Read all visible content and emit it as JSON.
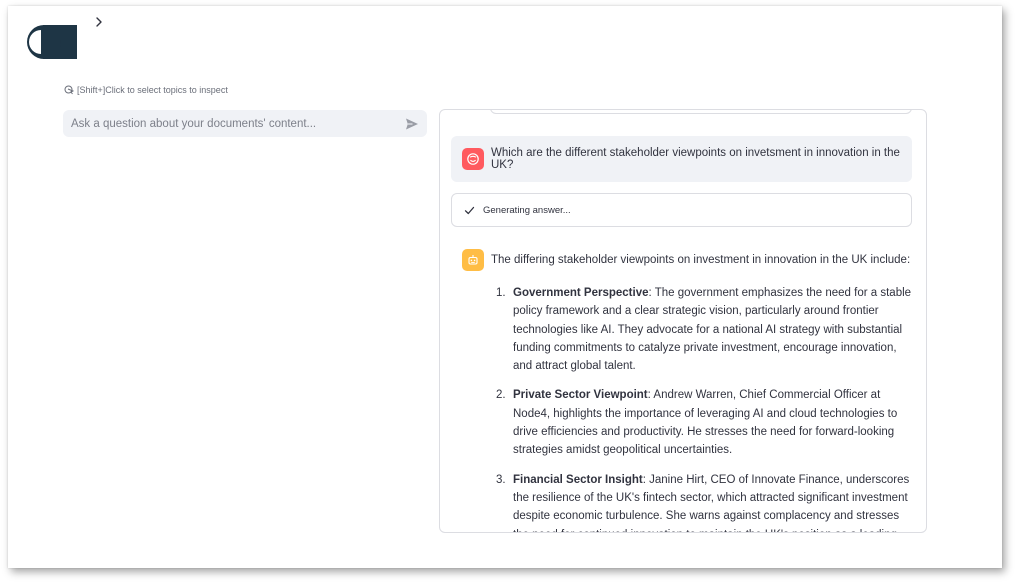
{
  "nav": {
    "logo_icon": "app-logo",
    "expand_icon": "chevron-right-icon"
  },
  "hint": {
    "icon": "inspect-cursor-icon",
    "text": "[Shift+]Click to select topics to inspect"
  },
  "query": {
    "placeholder": "Ask a question about your documents' content...",
    "value": "",
    "send_icon": "send-icon"
  },
  "chat": {
    "user_message": {
      "avatar_icon": "user-face-icon",
      "text": "Which are the different stakeholder viewpoints on invetsment in innovation in the UK?"
    },
    "status": {
      "icon": "check-icon",
      "text": "Generating answer..."
    },
    "assistant_message": {
      "avatar_icon": "robot-icon",
      "intro": "The differing stakeholder viewpoints on investment in innovation in the UK include:",
      "items": [
        {
          "number": "1.",
          "title": "Government Perspective",
          "body": ": The government emphasizes the need for a stable policy framework and a clear strategic vision, particularly around frontier technologies like AI. They advocate for a national AI strategy with substantial funding commitments to catalyze private investment, encourage innovation, and attract global talent."
        },
        {
          "number": "2.",
          "title": "Private Sector Viewpoint",
          "body": ": Andrew Warren, Chief Commercial Officer at Node4, highlights the importance of leveraging AI and cloud technologies to drive efficiencies and productivity. He stresses the need for forward-looking strategies amidst geopolitical uncertainties."
        },
        {
          "number": "3.",
          "title": "Financial Sector Insight",
          "body": ": Janine Hirt, CEO of Innovate Finance, underscores the resilience of the UK's fintech sector, which attracted significant investment despite economic turbulence. She warns against complacency and stresses the need for continued innovation to maintain the UK's position as a leading destination for venture funding."
        }
      ]
    }
  },
  "colors": {
    "user_avatar": "#ff5a5f",
    "bot_avatar": "#ffbd45",
    "logo": "#1e3545",
    "input_bg": "#f0f2f6"
  }
}
